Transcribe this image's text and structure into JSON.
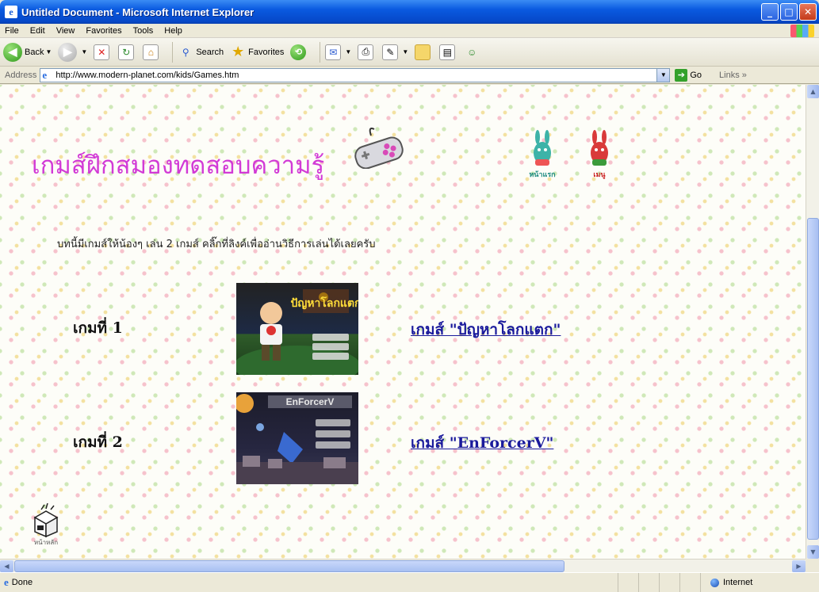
{
  "window": {
    "title": "Untitled Document - Microsoft Internet Explorer",
    "controls": {
      "minimize": "_",
      "maximize": "□",
      "close": "✕"
    }
  },
  "menu": [
    "File",
    "Edit",
    "View",
    "Favorites",
    "Tools",
    "Help"
  ],
  "toolbar": {
    "back_label": "Back",
    "search_label": "Search",
    "favorites_label": "Favorites"
  },
  "address": {
    "label": "Address",
    "url": "http://www.modern-planet.com/kids/Games.htm",
    "go_label": "Go",
    "links_label": "Links"
  },
  "page": {
    "heading": "เกมส์ฝึกสมองทดสอบความรู้",
    "nav_icons": [
      {
        "icon": "teal-bunny-icon",
        "caption": "หน้าแรก"
      },
      {
        "icon": "red-bunny-icon",
        "caption": "เมนู"
      }
    ],
    "intro": "บทนี้มีเกมส์ให้น้องๆ เล่น 2 เกมส์ คลิ๊กที่ลิงค์เพื่ออ่านวิธีการเล่นได้เลยครับ",
    "games": [
      {
        "label": "เกมที่ 1",
        "thumb_title": "ปัญหาโลกแตก",
        "link": "เกมส์ \"ปัญหาโลกแตก\""
      },
      {
        "label": "เกมที่ 2",
        "thumb_title": "EnForcerV",
        "link": "เกมส์ \"EnForcerV\""
      }
    ],
    "home_caption": "หน้าหลัก"
  },
  "status": {
    "text": "Done",
    "zone": "Internet"
  },
  "colors": {
    "heading": "#d23ad6",
    "link": "#1a1a9c",
    "titlebar": "#0a5ae0"
  }
}
